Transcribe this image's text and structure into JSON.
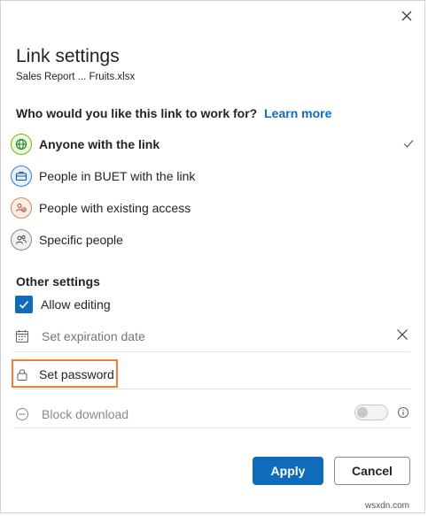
{
  "dialog": {
    "title": "Link settings",
    "filename": "Sales Report ... Fruits.xlsx",
    "close_icon": "close-icon"
  },
  "audience": {
    "question": "Who would you like this link to work for?",
    "learn_more": "Learn more",
    "options": [
      {
        "label": "Anyone with the link",
        "icon": "globe-icon",
        "selected": true
      },
      {
        "label": "People in BUET with the link",
        "icon": "briefcase-icon",
        "selected": false
      },
      {
        "label": "People with existing access",
        "icon": "people-access-icon",
        "selected": false
      },
      {
        "label": "Specific people",
        "icon": "people-icon",
        "selected": false
      }
    ]
  },
  "other_settings": {
    "title": "Other settings",
    "allow_editing": {
      "label": "Allow editing",
      "checked": true
    },
    "expiration": {
      "placeholder": "Set expiration date",
      "icon": "calendar-icon"
    },
    "password": {
      "label": "Set password",
      "icon": "lock-icon"
    },
    "block_download": {
      "label": "Block download",
      "enabled": false,
      "icon": "block-icon"
    }
  },
  "actions": {
    "apply": "Apply",
    "cancel": "Cancel"
  },
  "watermark": "wsxdn.com",
  "colors": {
    "accent": "#0f6cbd",
    "highlight": "#ed7d31"
  }
}
